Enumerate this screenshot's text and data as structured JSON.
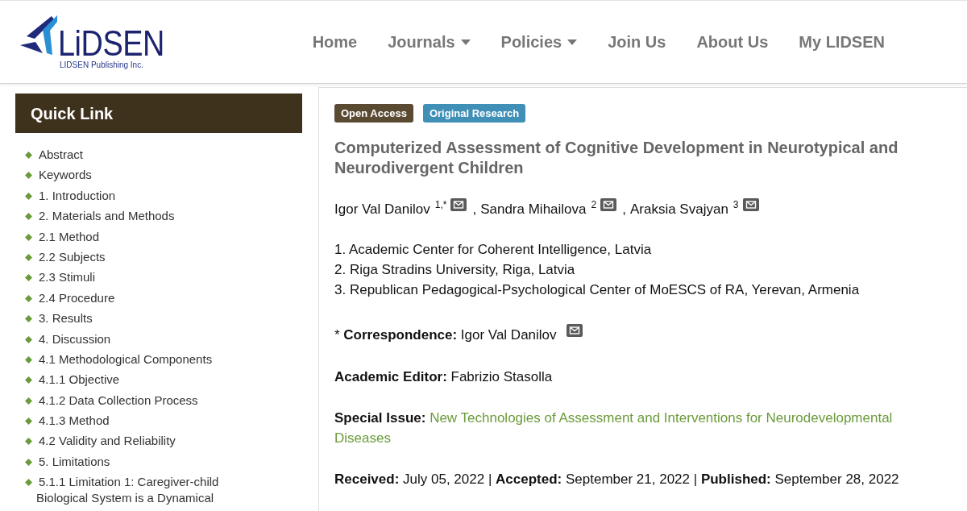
{
  "header": {
    "logo": {
      "wordmark": "LiDSEN",
      "tagline": "LIDSEN Publishing Inc."
    },
    "nav": [
      {
        "label": "Home",
        "has_menu": false
      },
      {
        "label": "Journals",
        "has_menu": true
      },
      {
        "label": "Policies",
        "has_menu": true
      },
      {
        "label": "Join Us",
        "has_menu": false
      },
      {
        "label": "About Us",
        "has_menu": false
      },
      {
        "label": "My LIDSEN",
        "has_menu": false
      }
    ]
  },
  "sidebar": {
    "title": "Quick Link",
    "items": [
      "Abstract",
      "Keywords",
      "1. Introduction",
      "2. Materials and Methods",
      "2.1 Method",
      "2.2 Subjects",
      "2.3 Stimuli",
      "2.4 Procedure",
      "3. Results",
      "4. Discussion",
      "4.1 Methodological Components",
      "4.1.1 Objective",
      "4.1.2 Data Collection Process",
      "4.1.3 Method",
      "4.2 Validity and Reliability",
      "5. Limitations",
      "5.1.1 Limitation 1: Caregiver-child Biological System is a Dynamical"
    ]
  },
  "article": {
    "badges": [
      {
        "label": "Open Access",
        "color": "#5b4a32"
      },
      {
        "label": "Original Research",
        "color": "#3f8fb6"
      }
    ],
    "title": "Computerized Assessment of Cognitive Development in Neurotypical and Neurodivergent Children",
    "authors": {
      "separator": ",",
      "list": [
        {
          "name": "Igor Val Danilov",
          "affiliation": "1,*",
          "email": true
        },
        {
          "name": "Sandra Mihailova",
          "affiliation": "2",
          "email": true
        },
        {
          "name": "Araksia Svajyan",
          "affiliation": "3",
          "email": true
        }
      ]
    },
    "affiliations": [
      "1. Academic Center for Coherent Intelligence, Latvia",
      "2. Riga Stradins University, Riga, Latvia",
      "3. Republican Pedagogical-Psychological Center of MoESCS of RA, Yerevan, Armenia"
    ],
    "correspondence": {
      "text": "* **Correspondence:** Igor Val Danilov",
      "email": true
    },
    "academic_editor": "**Academic Editor:** Fabrizio Stasolla",
    "special_issue": {
      "label": "Special Issue:",
      "link": "New Technologies of Assessment and Interventions for Neurodevelopmental Diseases"
    },
    "dates": "**Received:** July 05, 2022 | **Accepted:** September 21, 2022 | **Published:** September 28, 2022"
  }
}
